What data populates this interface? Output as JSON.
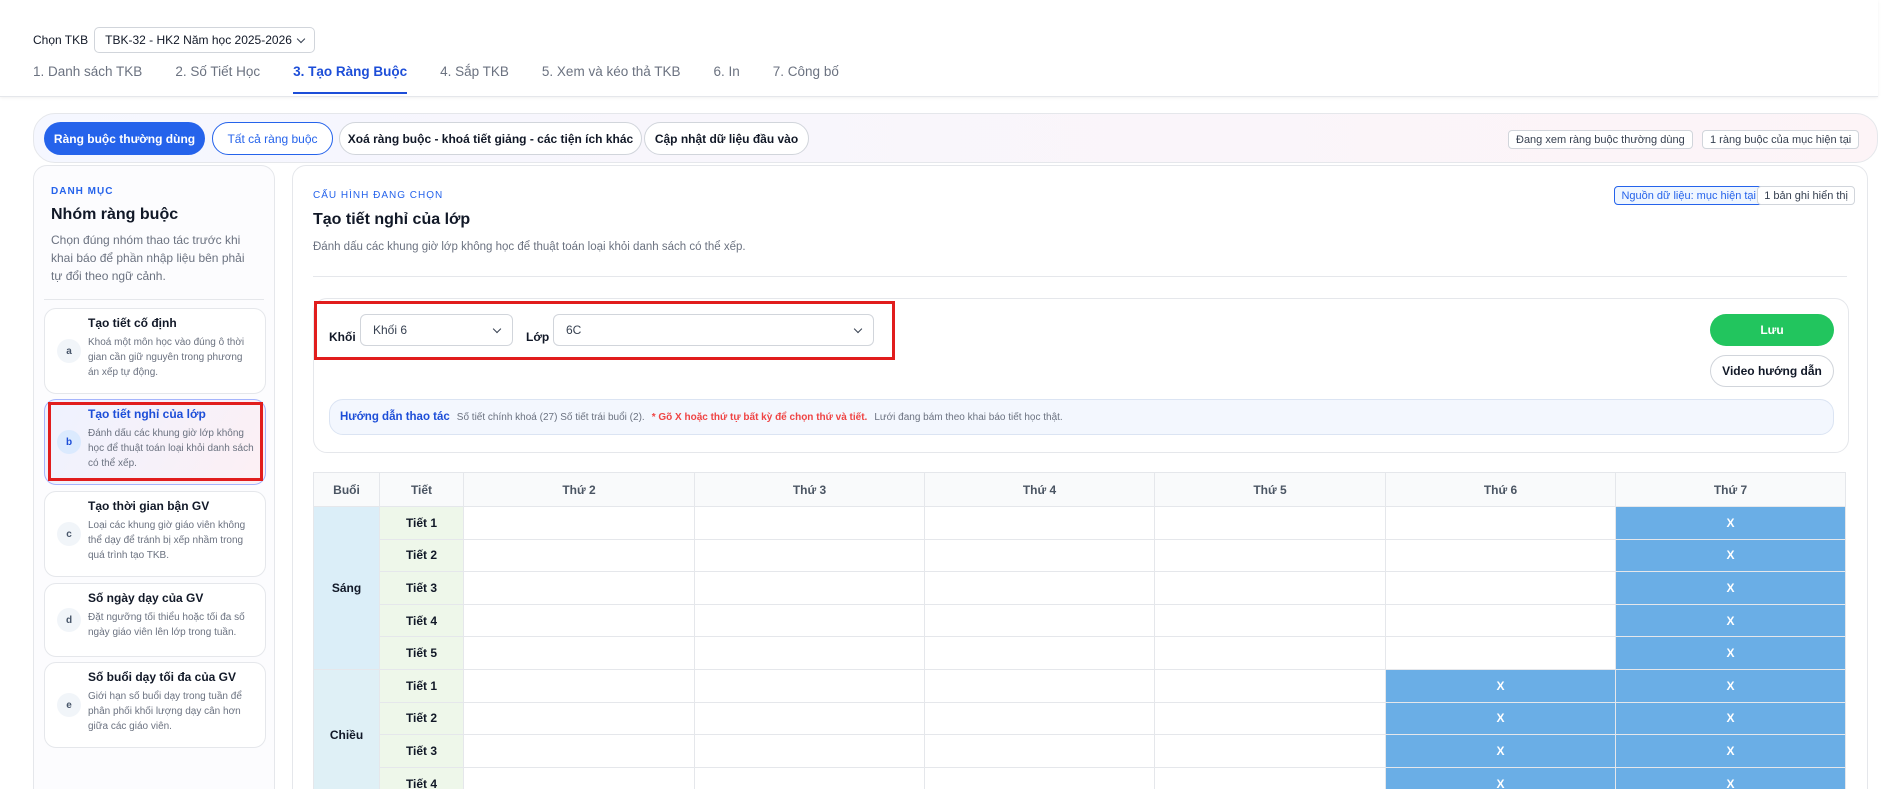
{
  "header": {
    "tkb_label": "Chọn TKB",
    "tkb_value": "TBK-32 - HK2 Năm học 2025-2026",
    "steps": [
      {
        "label": "1. Danh sách TKB"
      },
      {
        "label": "2. Số Tiết Học"
      },
      {
        "label": "3. Tạo Ràng Buộc"
      },
      {
        "label": "4. Sắp TKB"
      },
      {
        "label": "5. Xem và kéo thả TKB"
      },
      {
        "label": "6. In"
      },
      {
        "label": "7. Công bố"
      }
    ],
    "active_step": 2
  },
  "pills": {
    "common": "Ràng buộc thường dùng",
    "all": "Tất cả ràng buộc",
    "delete": "Xoá ràng buộc - khoá tiết giảng - các tiện ích khác",
    "update": "Cập nhật dữ liệu đầu vào",
    "tag_viewing": "Đang xem ràng buộc thường dùng",
    "tag_count": "1 ràng buộc của mục hiện tại"
  },
  "sidebar": {
    "overline": "DANH MỤC",
    "title": "Nhóm ràng buộc",
    "desc": "Chọn đúng nhóm thao tác trước khi khai báo để phần nhập liệu bên phải tự đổi theo ngữ cảnh.",
    "items": [
      {
        "letter": "a",
        "title": "Tạo tiết cố định",
        "desc": "Khoá một môn học vào đúng ô thời gian cần giữ nguyên trong phương án xếp tự động."
      },
      {
        "letter": "b",
        "title": "Tạo tiết nghỉ của lớp",
        "desc": "Đánh dấu các khung giờ lớp không học để thuật toán loại khỏi danh sách có thể xếp."
      },
      {
        "letter": "c",
        "title": "Tạo thời gian bận GV",
        "desc": "Loại các khung giờ giáo viên không thể dạy để tránh bị xếp nhầm trong quá trình tạo TKB."
      },
      {
        "letter": "d",
        "title": "Số ngày dạy của GV",
        "desc": "Đặt ngưỡng tối thiểu hoặc tối đa số ngày giáo viên lên lớp trong tuần."
      },
      {
        "letter": "e",
        "title": "Số buổi dạy tối đa của GV",
        "desc": "Giới hạn số buổi dạy trong tuần để phân phối khối lượng dạy cân hơn giữa các giáo viên."
      }
    ],
    "active_index": 1
  },
  "main": {
    "overline": "CẤU HÌNH ĐANG CHỌN",
    "title": "Tạo tiết nghỉ của lớp",
    "desc": "Đánh dấu các khung giờ lớp không học để thuật toán loại khỏi danh sách có thể xếp.",
    "source_tag": "Nguồn dữ liệu: mục hiện tại",
    "records_tag": "1 bản ghi hiển thị",
    "khoi_label": "Khối",
    "khoi_value": "Khối 6",
    "lop_label": "Lớp",
    "lop_value": "6C",
    "save_label": "Lưu",
    "video_label": "Video hướng dẫn",
    "guide_title": "Hướng dẫn thao tác",
    "guide_text1": "Số tiết chính khoá (27) Số tiết trái buổi (2).",
    "guide_text2": "* Gõ X hoặc thứ tự bất kỳ để chọn thứ và tiết.",
    "guide_text3": "Lưới đang bám theo khai báo tiết học thật."
  },
  "grid": {
    "col_session": "Buổi",
    "col_period": "Tiết",
    "days": [
      "Thứ 2",
      "Thứ 3",
      "Thứ 4",
      "Thứ 5",
      "Thứ 6",
      "Thứ 7"
    ],
    "sessions": [
      {
        "name": "Sáng",
        "rows": [
          {
            "period": "Tiết 1",
            "cells": [
              "",
              "",
              "",
              "",
              "",
              "X"
            ]
          },
          {
            "period": "Tiết 2",
            "cells": [
              "",
              "",
              "",
              "",
              "",
              "X"
            ]
          },
          {
            "period": "Tiết 3",
            "cells": [
              "",
              "",
              "",
              "",
              "",
              "X"
            ]
          },
          {
            "period": "Tiết 4",
            "cells": [
              "",
              "",
              "",
              "",
              "",
              "X"
            ]
          },
          {
            "period": "Tiết 5",
            "cells": [
              "",
              "",
              "",
              "",
              "",
              "X"
            ]
          }
        ]
      },
      {
        "name": "Chiều",
        "rows": [
          {
            "period": "Tiết 1",
            "cells": [
              "",
              "",
              "",
              "",
              "X",
              "X"
            ]
          },
          {
            "period": "Tiết 2",
            "cells": [
              "",
              "",
              "",
              "",
              "X",
              "X"
            ]
          },
          {
            "period": "Tiết 3",
            "cells": [
              "",
              "",
              "",
              "",
              "X",
              "X"
            ]
          },
          {
            "period": "Tiết 4",
            "cells": [
              "",
              "",
              "",
              "",
              "X",
              "X"
            ]
          }
        ]
      }
    ]
  },
  "colors": {
    "accent": "#2563eb",
    "save": "#22c55e",
    "marked_cell": "#6aaee6",
    "highlight": "#e11d1d"
  }
}
